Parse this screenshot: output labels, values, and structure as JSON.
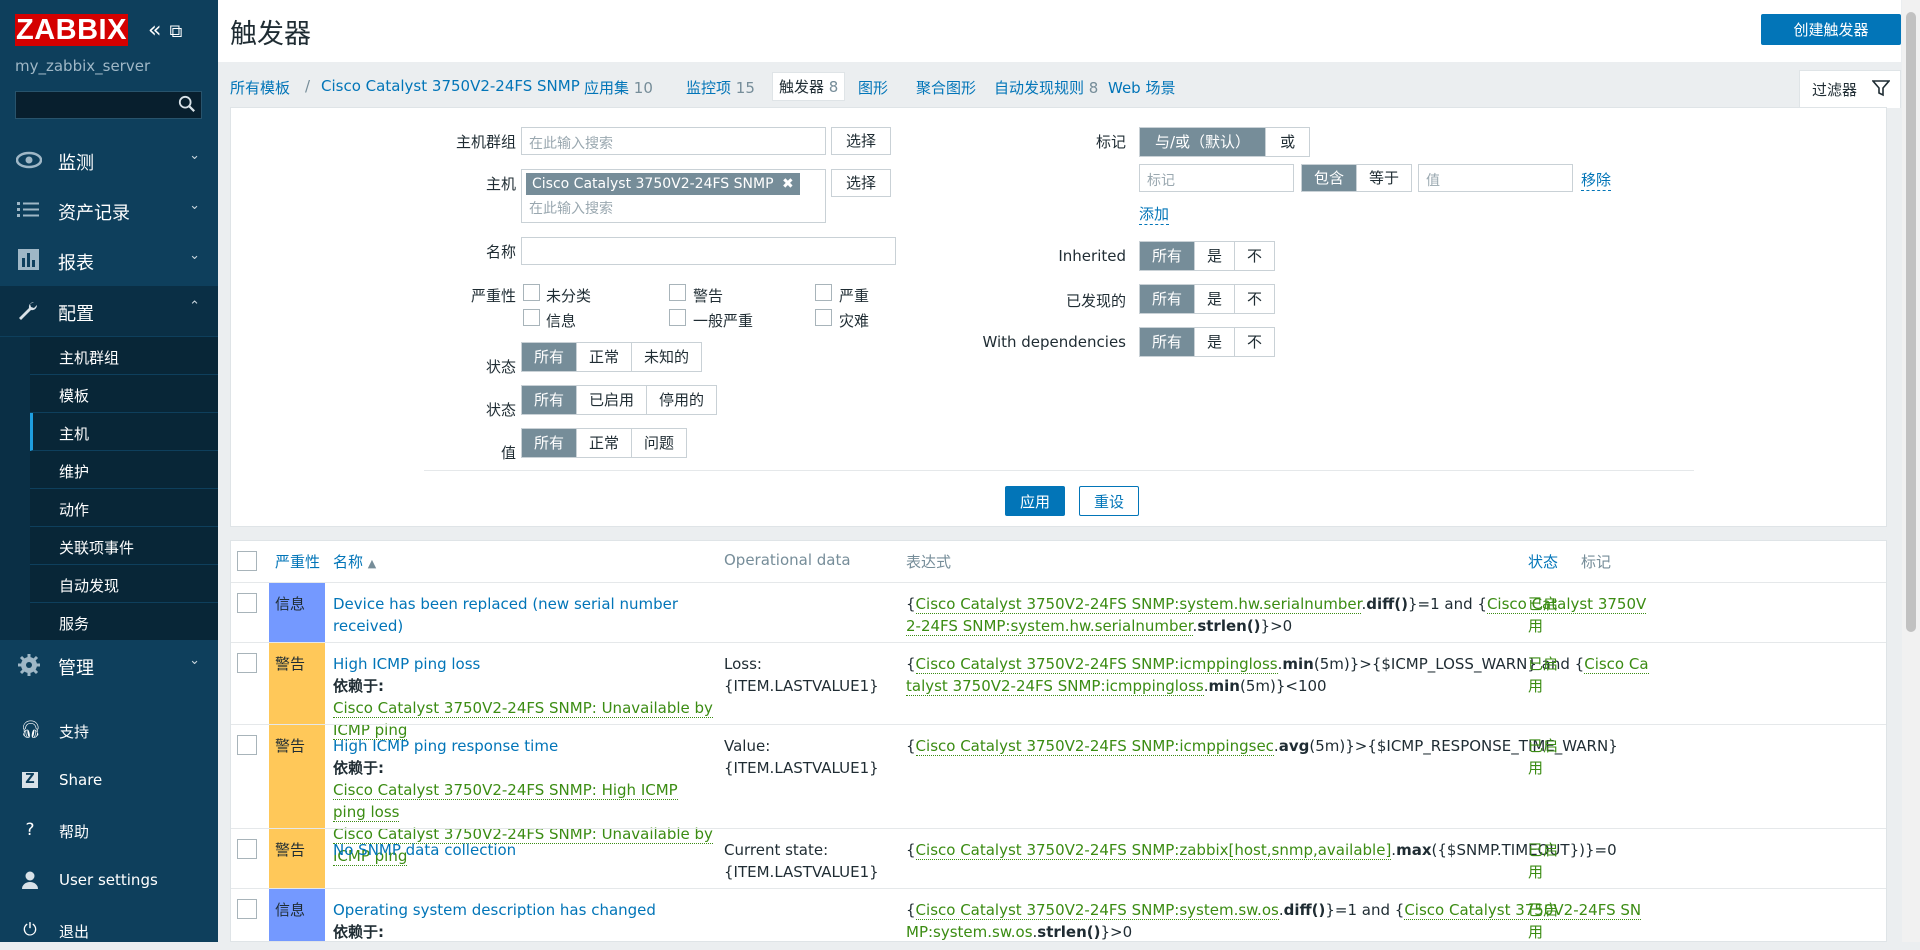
{
  "sidebar": {
    "logo": "ZABBIX",
    "server": "my_zabbix_server",
    "search_placeholder": "",
    "menu": [
      {
        "label": "监测",
        "icon": "eye-icon"
      },
      {
        "label": "资产记录",
        "icon": "list-icon"
      },
      {
        "label": "报表",
        "icon": "bar-chart-icon"
      },
      {
        "label": "配置",
        "icon": "wrench-icon"
      },
      {
        "label": "管理",
        "icon": "gear-icon"
      }
    ],
    "config_sub": [
      "主机群组",
      "模板",
      "主机",
      "维护",
      "动作",
      "关联项事件",
      "自动发现",
      "服务"
    ],
    "bottom": [
      {
        "label": "支持",
        "icon": "headset-icon"
      },
      {
        "label": "Share",
        "icon": "share-icon"
      },
      {
        "label": "帮助",
        "icon": "help-icon"
      },
      {
        "label": "User settings",
        "icon": "user-icon"
      },
      {
        "label": "退出",
        "icon": "power-icon"
      }
    ]
  },
  "header": {
    "title": "触发器",
    "create_button": "创建触发器"
  },
  "breadcrumbs": {
    "all_templates": "所有模板",
    "sep": "/",
    "host": "Cisco Catalyst 3750V2-24FS SNMP",
    "apps": "应用集",
    "apps_count": "10",
    "items": "监控项",
    "items_count": "15",
    "triggers": "触发器",
    "triggers_count": "8",
    "graphs": "图形",
    "screens": "聚合图形",
    "discovery": "自动发现规则",
    "discovery_count": "8",
    "web": "Web 场景"
  },
  "filter": {
    "tab_label": "过滤器",
    "host_group_label": "主机群组",
    "search_placeholder": "在此输入搜索",
    "select": "选择",
    "host_label": "主机",
    "host_tag": "Cisco Catalyst 3750V2-24FS SNMP",
    "name_label": "名称",
    "severity_label": "严重性",
    "severities": [
      "未分类",
      "警告",
      "严重",
      "信息",
      "一般严重",
      "灾难"
    ],
    "state_label": "状态",
    "state_opts": [
      "所有",
      "正常",
      "未知的"
    ],
    "status_label": "状态",
    "status_opts": [
      "所有",
      "已启用",
      "停用的"
    ],
    "value_label": "值",
    "value_opts": [
      "所有",
      "正常",
      "问题"
    ],
    "tags_label": "标记",
    "tags_mode": [
      "与/或（默认）",
      "或"
    ],
    "tag_placeholder": "标记",
    "tag_ops": [
      "包含",
      "等于"
    ],
    "value_placeholder": "值",
    "remove": "移除",
    "add": "添加",
    "inherited_label": "Inherited",
    "discovered_label": "已发现的",
    "deps_label": "With dependencies",
    "tri_opts": [
      "所有",
      "是",
      "不"
    ],
    "apply": "应用",
    "reset": "重设"
  },
  "table": {
    "headers": {
      "severity": "严重性",
      "name": "名称",
      "opdata": "Operational data",
      "expression": "表达式",
      "status": "状态",
      "tags": "标记"
    },
    "dep_label": "依赖于:",
    "rows": [
      {
        "severity": "信息",
        "sev_color": "#7499ff",
        "name": "Device has been replaced (new serial number received)",
        "deps": [],
        "opdata": "",
        "status": "已启用"
      },
      {
        "severity": "警告",
        "sev_color": "#ffc859",
        "name": "High ICMP ping loss",
        "deps": [
          "Cisco Catalyst 3750V2-24FS SNMP: Unavailable by ICMP ping"
        ],
        "opdata": "Loss: {ITEM.LASTVALUE1}",
        "status": "已启用"
      },
      {
        "severity": "警告",
        "sev_color": "#ffc859",
        "name": "High ICMP ping response time",
        "deps": [
          "Cisco Catalyst 3750V2-24FS SNMP: High ICMP ping loss",
          "Cisco Catalyst 3750V2-24FS SNMP: Unavailable by ICMP ping"
        ],
        "opdata": "Value: {ITEM.LASTVALUE1}",
        "status": "已启用"
      },
      {
        "severity": "警告",
        "sev_color": "#ffc859",
        "name": "No SNMP data collection",
        "deps": [],
        "opdata": "Current state: {ITEM.LASTVALUE1}",
        "status": "已启用"
      },
      {
        "severity": "信息",
        "sev_color": "#7499ff",
        "name": "Operating system description has changed",
        "deps": [],
        "opdata": "",
        "status": "已启用"
      }
    ],
    "expr": {
      "r0a": "Cisco Catalyst 3750V2-24FS SNMP:system.hw.serialnumber",
      "r0f1": "diff()",
      "r0m": "}=1 and {",
      "r0b": "Cisco Catalyst 3750V2-24FS SNMP:system.hw.serialnumber",
      "r0f2": "strlen()",
      "r0e": "}>0",
      "r1a": "Cisco Catalyst 3750V2-24FS SNMP:icmppingloss",
      "r1f1": "min",
      "r1p1": "(5m)}>{$ICMP_LOSS_WARN} and {",
      "r1b": "Cisco Catalyst 3750V2-24FS SNMP:icmppingloss",
      "r1f2": "min",
      "r1e": "(5m)}<100",
      "r2a": "Cisco Catalyst 3750V2-24FS SNMP:icmppingsec",
      "r2f": "avg",
      "r2e": "(5m)}>{$ICMP_RESPONSE_TIME_WARN}",
      "r3a": "Cisco Catalyst 3750V2-24FS SNMP:zabbix[host,snmp,available]",
      "r3f": "max",
      "r3e": "({$SNMP.TIMEOUT})}=0",
      "r4a": "Cisco Catalyst 3750V2-24FS SNMP:system.sw.os",
      "r4f1": "diff()",
      "r4m": "}=1 and {",
      "r4b": "Cisco Catalyst 3750V2-24FS SNMP:system.sw.os",
      "r4f2": "strlen()",
      "r4e": "}>0",
      "open": "{",
      "dot": "."
    }
  }
}
